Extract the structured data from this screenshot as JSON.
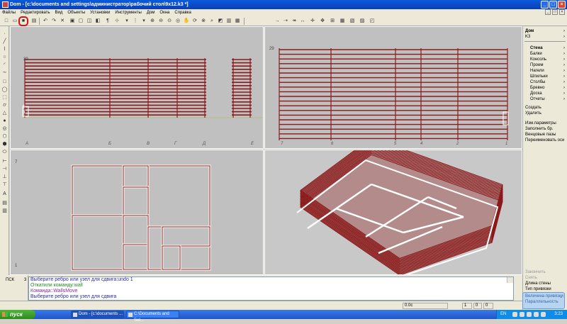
{
  "window": {
    "title": "Dom - [c:\\documents and settings\\администратор\\рабочий стол\\9х12.k3 *]"
  },
  "window_controls": [
    "_",
    "□",
    "×"
  ],
  "menu": {
    "items": [
      "Файлы",
      "Редактировать",
      "Вид",
      "Объекты",
      "Установки",
      "Инструменты",
      "Дом",
      "Окна",
      "Справка"
    ]
  },
  "viewports": {
    "front": {
      "axis_labels": [
        "А",
        "Б",
        "В",
        "Г",
        "Д",
        "Е"
      ],
      "height_marks": [
        "29",
        "1",
        "3"
      ]
    },
    "side": {
      "axis_labels": [
        "7",
        "6",
        "5",
        "4",
        "2",
        "1"
      ],
      "height_marks": [
        "29"
      ]
    },
    "plan": {
      "axis_labels": [
        "7",
        "1"
      ]
    }
  },
  "side_panel": {
    "title": "Дом",
    "subtitle": "K3",
    "section_title": "Стена",
    "items": [
      "Балки",
      "Консоль",
      "Проем",
      "Нагели",
      "Шпильки",
      "Столбы",
      "Бревно",
      "Доска",
      "Отчеты"
    ],
    "actions": [
      "Создать",
      "Удалить"
    ],
    "params": [
      "Изм.параметры",
      "Заполнить бр.",
      "Венцовые пазы",
      "Переименовать оси"
    ],
    "bottom": [
      "Закончить",
      "Снять",
      "Длина стены",
      "Тип привязки"
    ]
  },
  "command": {
    "label": "ПСК",
    "count": "3",
    "lines": [
      "Выберите ребро или узел для сдвига:undo 1",
      "Откатили команду:wall",
      "Команда::WallsMove",
      "Выберите ребро или узел для сдвига"
    ]
  },
  "statusbar": {
    "coord": "0.0с",
    "val1": "1",
    "val2": "0",
    "val3": "0"
  },
  "taskbar": {
    "start": "пуск",
    "tasks": [
      "Dom - [c:\\documents ...",
      "C:\\Documents and Set..."
    ],
    "lang": "EN",
    "clock": "3:23"
  },
  "popup": {
    "lines": [
      "Величина привязки",
      "Параллельность"
    ]
  }
}
